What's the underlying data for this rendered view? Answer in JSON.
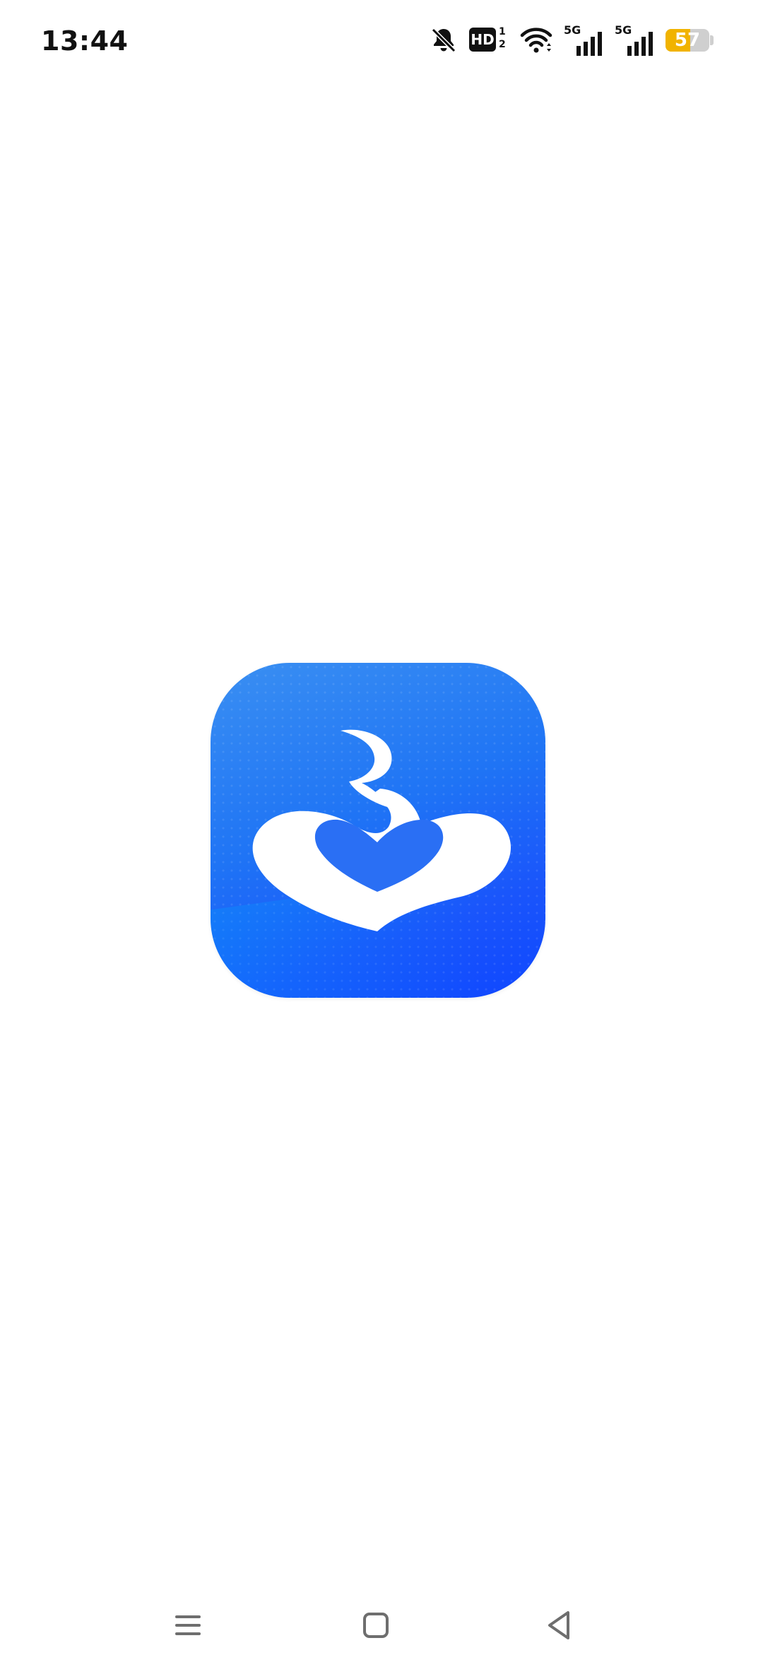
{
  "status_bar": {
    "time": "13:44",
    "hd": {
      "label": "HD",
      "sup": "1",
      "sub": "2"
    },
    "signals": [
      {
        "label": "5G"
      },
      {
        "label": "5G"
      }
    ],
    "battery": {
      "level": "57",
      "color": "#f1b300"
    },
    "icons": [
      "bell-muted-icon",
      "hd-icon",
      "wifi-icon",
      "signal-icon",
      "signal-icon",
      "battery-icon"
    ]
  },
  "splash": {
    "logo_icon": "app-logo-heart-icon",
    "colors": {
      "primary": "#1f74f5",
      "secondary": "#0f47ff"
    }
  },
  "nav_bar": {
    "buttons": [
      {
        "name": "menu",
        "icon": "menu-icon"
      },
      {
        "name": "home",
        "icon": "home-square-icon"
      },
      {
        "name": "back",
        "icon": "back-triangle-icon"
      }
    ]
  }
}
